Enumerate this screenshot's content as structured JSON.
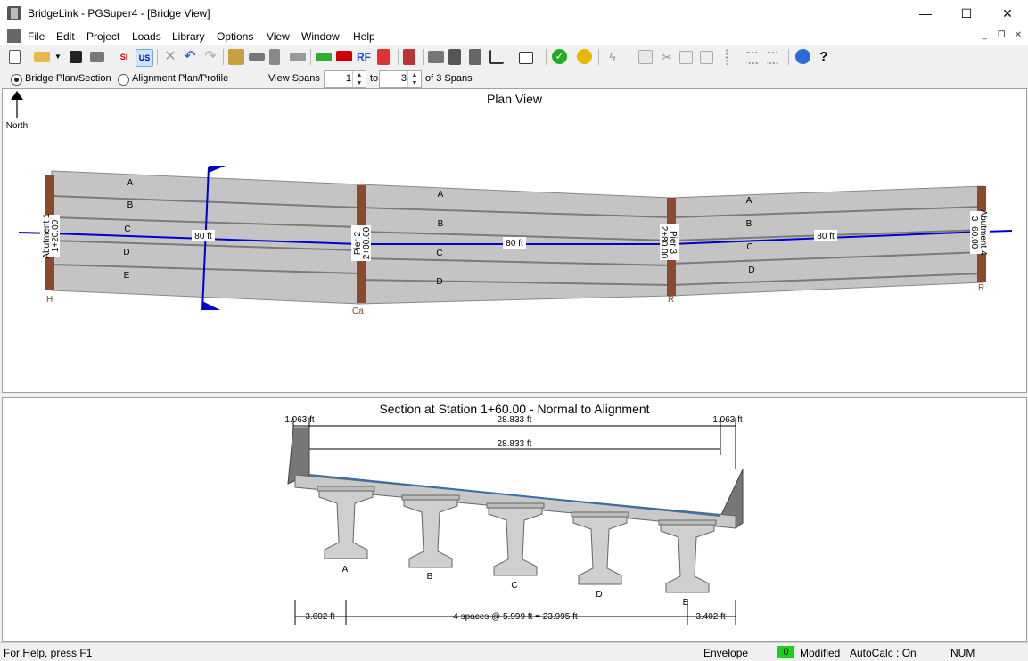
{
  "window": {
    "title": "BridgeLink - PGSuper4 - [Bridge View]",
    "controls": {
      "minimize": "—",
      "maximize": "☐",
      "close": "✕"
    }
  },
  "menu": {
    "items": [
      "File",
      "Edit",
      "Project",
      "Loads",
      "Library",
      "Options",
      "View",
      "Window",
      "Help"
    ],
    "mdi": {
      "minimize": "_",
      "restore": "❐",
      "close": "✕"
    }
  },
  "toolbar": {
    "icons": [
      "new-icon",
      "open-icon",
      "dropdown-icon",
      "save-icon",
      "print-icon",
      "si-units-icon",
      "us-units-icon",
      "delete-icon",
      "undo-icon",
      "redo-icon",
      "edit-bridge-icon",
      "edit-girder-icon",
      "edit-segment-icon",
      "edit-span-icon",
      "loads-icon",
      "live-load-icon",
      "rf-icon",
      "stress-icon",
      "library-icon",
      "analysis-icon",
      "girder-properties-icon",
      "section-icon",
      "graph-icon",
      "report-icon",
      "check-icon",
      "wizard-icon",
      "lightning-icon",
      "paste-icon",
      "cut-icon",
      "copy-icon",
      "edit-icon",
      "align-icon",
      "spacing-icon",
      "distribute-icon",
      "globe-icon",
      "help-icon"
    ],
    "si_label": "SI",
    "us_label": "US",
    "rf_label": "RF"
  },
  "view_controls": {
    "option1": "Bridge Plan/Section",
    "option2": "Alignment Plan/Profile",
    "view_spans_label": "View Spans",
    "from_value": "1",
    "to_label": "to",
    "to_value": "3",
    "of_label": "of 3 Spans"
  },
  "plan_view": {
    "title": "Plan View",
    "north_label": "North",
    "span_lengths": [
      "80 ft",
      "80 ft",
      "80 ft"
    ],
    "abutment1": [
      "Abutment 1",
      "1+20.00"
    ],
    "pier2": [
      "Pier 2",
      "2+00.00"
    ],
    "pier3": [
      "Pier 3",
      "2+80.00"
    ],
    "abutment4": [
      "Abutment 4",
      "3+60.00"
    ],
    "bearing_labels": [
      "H",
      "Ca",
      "R",
      "R"
    ],
    "span1_girders": [
      "A",
      "B",
      "C",
      "D",
      "E"
    ],
    "span2_girders": [
      "A",
      "B",
      "C",
      "D"
    ],
    "span3_girders": [
      "A",
      "B",
      "C",
      "D"
    ]
  },
  "section_view": {
    "title": "Section at Station 1+60.00 - Normal to Alignment",
    "dims_top": [
      "1.063 ft",
      "28.833 ft",
      "1.063 ft"
    ],
    "dim_mid": "28.833 ft",
    "girders": [
      "A",
      "B",
      "C",
      "D",
      "E"
    ],
    "dims_bottom": [
      "3.602 ft",
      "4 spaces @ 5.999 ft = 23.995 ft",
      "3.402 ft"
    ]
  },
  "status": {
    "help": "For Help, press F1",
    "mode": "Envelope",
    "count": "0",
    "modified": "Modified",
    "autocalc": "AutoCalc : On",
    "num": "NUM"
  },
  "colors": {
    "alignment": "#0000cc",
    "girder": "#c8c8c8",
    "pier": "#8b4a2b",
    "status_green": "#17d11b"
  }
}
